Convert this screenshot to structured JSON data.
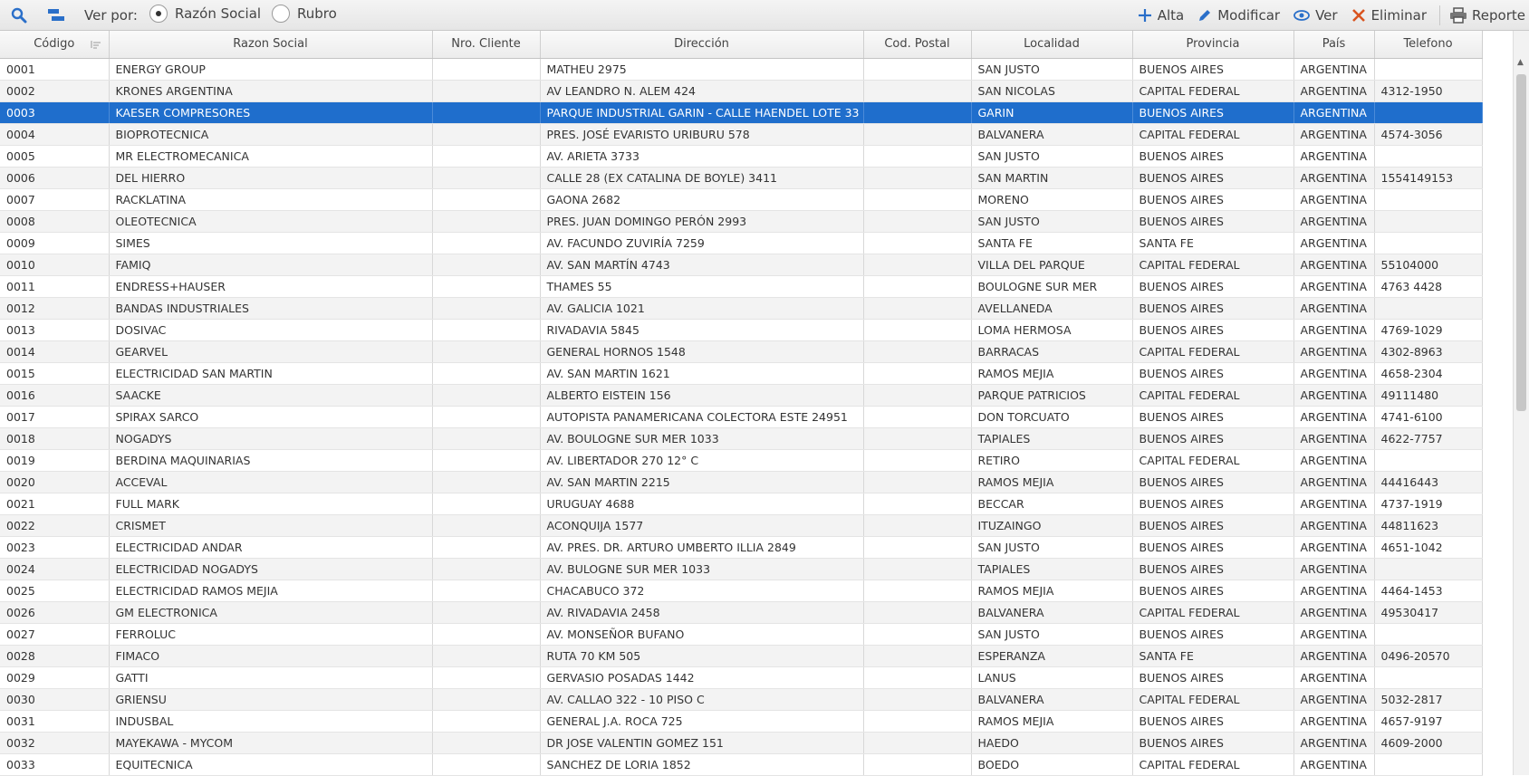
{
  "toolbar": {
    "ver_por_label": "Ver por:",
    "radio_options": [
      {
        "label": "Razón Social",
        "checked": true
      },
      {
        "label": "Rubro",
        "checked": false
      }
    ],
    "actions": [
      {
        "label": "Alta",
        "icon": "plus-icon",
        "color": "#2a6fc9"
      },
      {
        "label": "Modificar",
        "icon": "pencil-icon",
        "color": "#2a6fc9"
      },
      {
        "label": "Ver",
        "icon": "eye-icon",
        "color": "#2a6fc9"
      },
      {
        "label": "Eliminar",
        "icon": "x-icon",
        "color": "#d9531e"
      },
      {
        "label": "Reporte",
        "icon": "printer-icon",
        "color": "#555555"
      }
    ]
  },
  "colors": {
    "selected_row": "#1f6ecc",
    "accent": "#2a6fc9"
  },
  "table": {
    "columns": [
      "Código",
      "Razon Social",
      "Nro. Cliente",
      "Dirección",
      "Cod. Postal",
      "Localidad",
      "Provincia",
      "País",
      "Telefono"
    ],
    "selected_row_index": 2,
    "rows": [
      [
        "0001",
        "ENERGY GROUP",
        "",
        "MATHEU 2975",
        "",
        "SAN JUSTO",
        "BUENOS AIRES",
        "ARGENTINA",
        ""
      ],
      [
        "0002",
        "KRONES ARGENTINA",
        "",
        "AV LEANDRO N. ALEM 424",
        "",
        "SAN NICOLAS",
        "CAPITAL FEDERAL",
        "ARGENTINA",
        "4312-1950"
      ],
      [
        "0003",
        "KAESER COMPRESORES",
        "",
        "PARQUE INDUSTRIAL GARIN - CALLE HAENDEL LOTE 33",
        "",
        "GARIN",
        "BUENOS AIRES",
        "ARGENTINA",
        ""
      ],
      [
        "0004",
        "BIOPROTECNICA",
        "",
        "PRES. JOSÉ EVARISTO URIBURU 578",
        "",
        "BALVANERA",
        "CAPITAL FEDERAL",
        "ARGENTINA",
        "4574-3056"
      ],
      [
        "0005",
        "MR ELECTROMECANICA",
        "",
        "AV. ARIETA 3733",
        "",
        "SAN JUSTO",
        "BUENOS AIRES",
        "ARGENTINA",
        ""
      ],
      [
        "0006",
        "DEL HIERRO",
        "",
        "CALLE 28 (EX CATALINA DE BOYLE) 3411",
        "",
        "SAN MARTIN",
        "BUENOS AIRES",
        "ARGENTINA",
        "1554149153"
      ],
      [
        "0007",
        "RACKLATINA",
        "",
        "GAONA 2682",
        "",
        "MORENO",
        "BUENOS AIRES",
        "ARGENTINA",
        ""
      ],
      [
        "0008",
        "OLEOTECNICA",
        "",
        "PRES. JUAN DOMINGO PERÓN 2993",
        "",
        "SAN JUSTO",
        "BUENOS AIRES",
        "ARGENTINA",
        ""
      ],
      [
        "0009",
        "SIMES",
        "",
        "AV. FACUNDO ZUVIRÍA 7259",
        "",
        "SANTA FE",
        "SANTA FE",
        "ARGENTINA",
        ""
      ],
      [
        "0010",
        "FAMIQ",
        "",
        "AV. SAN MARTÍN 4743",
        "",
        "VILLA DEL PARQUE",
        "CAPITAL FEDERAL",
        "ARGENTINA",
        "55104000"
      ],
      [
        "0011",
        "ENDRESS+HAUSER",
        "",
        "THAMES 55",
        "",
        "BOULOGNE SUR MER",
        "BUENOS AIRES",
        "ARGENTINA",
        "4763 4428"
      ],
      [
        "0012",
        "BANDAS INDUSTRIALES",
        "",
        "AV. GALICIA 1021",
        "",
        "AVELLANEDA",
        "BUENOS AIRES",
        "ARGENTINA",
        ""
      ],
      [
        "0013",
        "DOSIVAC",
        "",
        "RIVADAVIA 5845",
        "",
        "LOMA HERMOSA",
        "BUENOS AIRES",
        "ARGENTINA",
        "4769-1029"
      ],
      [
        "0014",
        "GEARVEL",
        "",
        "GENERAL HORNOS 1548",
        "",
        "BARRACAS",
        "CAPITAL FEDERAL",
        "ARGENTINA",
        "4302-8963"
      ],
      [
        "0015",
        "ELECTRICIDAD SAN MARTIN",
        "",
        "AV. SAN MARTIN 1621",
        "",
        "RAMOS MEJIA",
        "BUENOS AIRES",
        "ARGENTINA",
        "4658-2304"
      ],
      [
        "0016",
        "SAACKE",
        "",
        "ALBERTO EISTEIN 156",
        "",
        "PARQUE PATRICIOS",
        "CAPITAL FEDERAL",
        "ARGENTINA",
        "49111480"
      ],
      [
        "0017",
        "SPIRAX SARCO",
        "",
        "AUTOPISTA PANAMERICANA COLECTORA ESTE 24951",
        "",
        "DON TORCUATO",
        "BUENOS AIRES",
        "ARGENTINA",
        "4741-6100"
      ],
      [
        "0018",
        "NOGADYS",
        "",
        "AV. BOULOGNE SUR MER 1033",
        "",
        "TAPIALES",
        "BUENOS AIRES",
        "ARGENTINA",
        "4622-7757"
      ],
      [
        "0019",
        "BERDINA MAQUINARIAS",
        "",
        "AV. LIBERTADOR 270 12° C",
        "",
        "RETIRO",
        "CAPITAL FEDERAL",
        "ARGENTINA",
        ""
      ],
      [
        "0020",
        "ACCEVAL",
        "",
        "AV. SAN MARTIN 2215",
        "",
        "RAMOS MEJIA",
        "BUENOS AIRES",
        "ARGENTINA",
        "44416443"
      ],
      [
        "0021",
        "FULL MARK",
        "",
        "URUGUAY 4688",
        "",
        "BECCAR",
        "BUENOS AIRES",
        "ARGENTINA",
        "4737-1919"
      ],
      [
        "0022",
        "CRISMET",
        "",
        "ACONQUIJA 1577",
        "",
        "ITUZAINGO",
        "BUENOS AIRES",
        "ARGENTINA",
        "44811623"
      ],
      [
        "0023",
        "ELECTRICIDAD ANDAR",
        "",
        "AV. PRES. DR. ARTURO UMBERTO ILLIA 2849",
        "",
        "SAN JUSTO",
        "BUENOS AIRES",
        "ARGENTINA",
        "4651-1042"
      ],
      [
        "0024",
        "ELECTRICIDAD NOGADYS",
        "",
        "AV. BULOGNE SUR MER 1033",
        "",
        "TAPIALES",
        "BUENOS AIRES",
        "ARGENTINA",
        ""
      ],
      [
        "0025",
        "ELECTRICIDAD RAMOS MEJIA",
        "",
        "CHACABUCO 372",
        "",
        "RAMOS MEJIA",
        "BUENOS AIRES",
        "ARGENTINA",
        "4464-1453"
      ],
      [
        "0026",
        "GM ELECTRONICA",
        "",
        "AV. RIVADAVIA 2458",
        "",
        "BALVANERA",
        "CAPITAL FEDERAL",
        "ARGENTINA",
        "49530417"
      ],
      [
        "0027",
        "FERROLUC",
        "",
        "AV. MONSEÑOR BUFANO",
        "",
        "SAN JUSTO",
        "BUENOS AIRES",
        "ARGENTINA",
        ""
      ],
      [
        "0028",
        "FIMACO",
        "",
        "RUTA 70 KM 505",
        "",
        "ESPERANZA",
        "SANTA FE",
        "ARGENTINA",
        "0496-20570"
      ],
      [
        "0029",
        "GATTI",
        "",
        "GERVASIO POSADAS 1442",
        "",
        "LANUS",
        "BUENOS AIRES",
        "ARGENTINA",
        ""
      ],
      [
        "0030",
        "GRIENSU",
        "",
        "AV. CALLAO 322 - 10 PISO C",
        "",
        "BALVANERA",
        "CAPITAL FEDERAL",
        "ARGENTINA",
        "5032-2817"
      ],
      [
        "0031",
        "INDUSBAL",
        "",
        "GENERAL J.A. ROCA 725",
        "",
        "RAMOS MEJIA",
        "BUENOS AIRES",
        "ARGENTINA",
        "4657-9197"
      ],
      [
        "0032",
        "MAYEKAWA - MYCOM",
        "",
        "DR JOSE VALENTIN GOMEZ 151",
        "",
        "HAEDO",
        "BUENOS AIRES",
        "ARGENTINA",
        "4609-2000"
      ],
      [
        "0033",
        "EQUITECNICA",
        "",
        "SANCHEZ DE LORIA 1852",
        "",
        "BOEDO",
        "CAPITAL FEDERAL",
        "ARGENTINA",
        ""
      ]
    ]
  }
}
